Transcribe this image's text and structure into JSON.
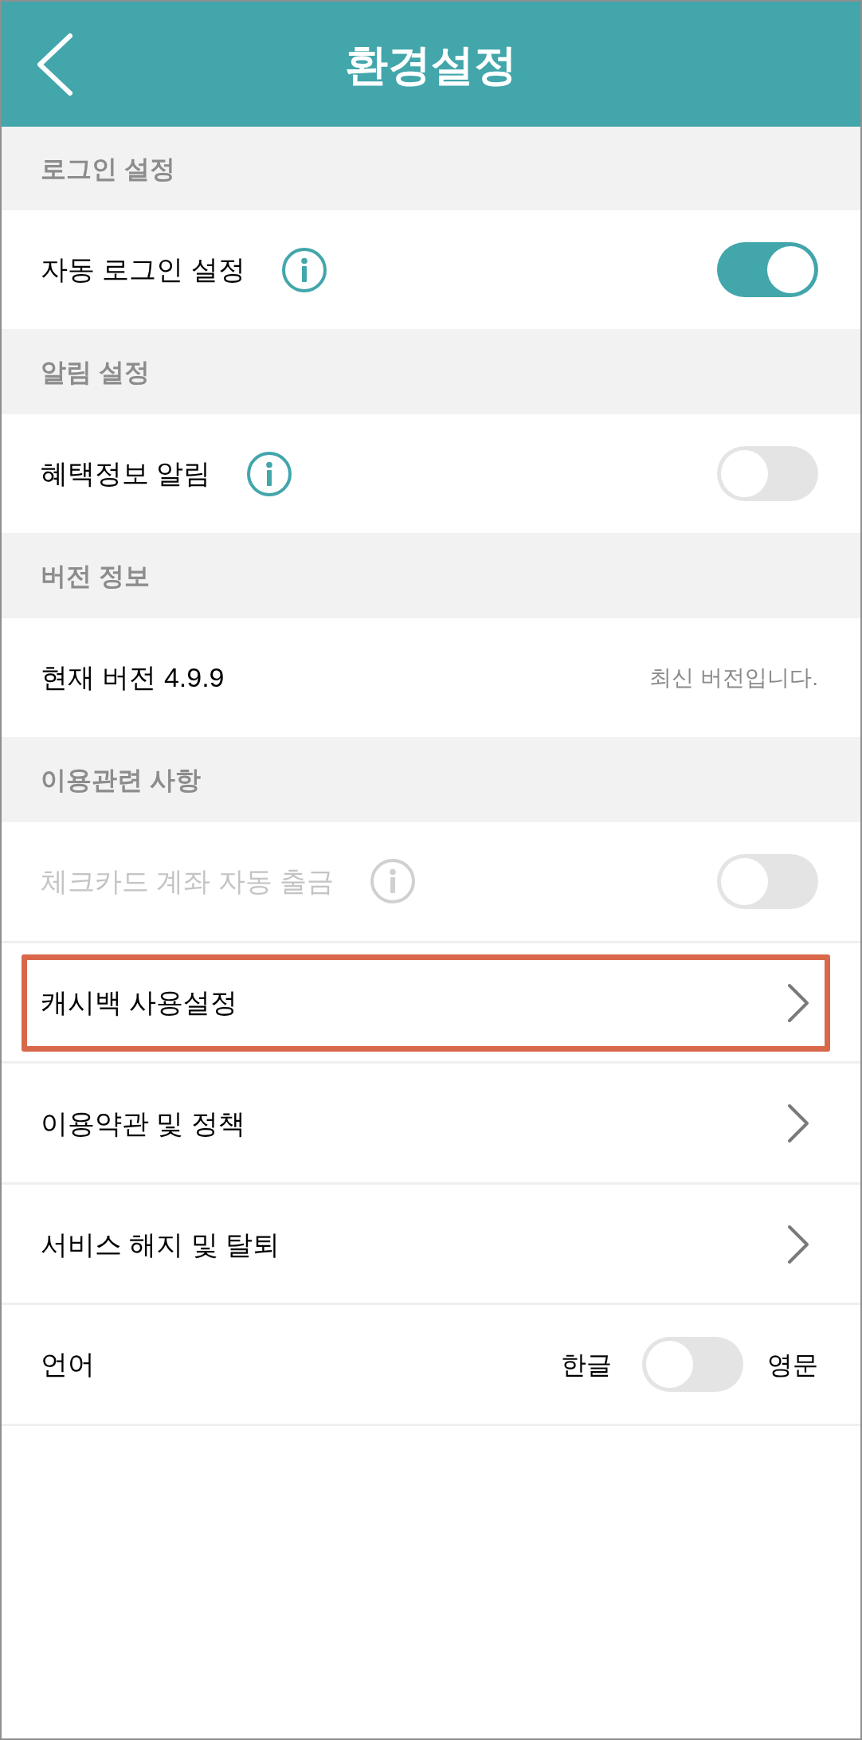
{
  "app_bar": {
    "title": "환경설정"
  },
  "sections": [
    {
      "title": "로그인 설정",
      "rows": [
        {
          "kind": "toggle",
          "label": "자동 로그인 설정",
          "info": true,
          "on": true,
          "disabled": false
        }
      ]
    },
    {
      "title": "알림 설정",
      "rows": [
        {
          "kind": "toggle",
          "label": "혜택정보 알림",
          "info": true,
          "on": false,
          "disabled": false
        }
      ]
    },
    {
      "title": "버전 정보",
      "rows": [
        {
          "kind": "value",
          "label": "현재 버전 4.9.9",
          "value": "최신 버전입니다."
        }
      ]
    },
    {
      "title": "이용관련 사항",
      "rows": [
        {
          "kind": "toggle",
          "label": "체크카드 계좌 자동 출금",
          "info": true,
          "on": false,
          "disabled": true
        },
        {
          "kind": "link",
          "label": "캐시백 사용설정",
          "highlighted": true
        },
        {
          "kind": "link",
          "label": "이용약관 및 정책",
          "highlighted": false
        },
        {
          "kind": "link",
          "label": "서비스 해지 및 탈퇴",
          "highlighted": false
        },
        {
          "kind": "choice",
          "label": "언어",
          "option_left": "한글",
          "option_right": "영문",
          "on": false
        }
      ]
    }
  ]
}
